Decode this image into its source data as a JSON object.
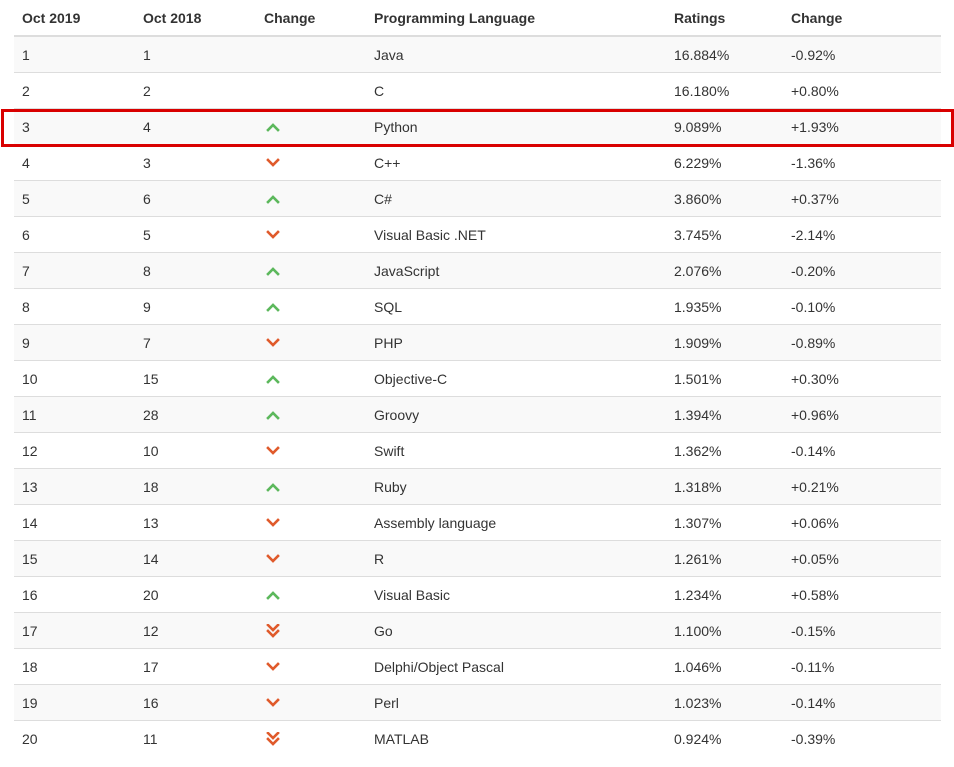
{
  "headers": [
    "Oct 2019",
    "Oct 2018",
    "Change",
    "Programming Language",
    "Ratings",
    "Change"
  ],
  "colors": {
    "up": "#5cb85c",
    "down": "#e05a2b",
    "highlight": "#d90000"
  },
  "highlighted_language": "Python",
  "rows": [
    {
      "now": "1",
      "prev": "1",
      "trend": "none",
      "language": "Java",
      "rating": "16.884%",
      "change": "-0.92%"
    },
    {
      "now": "2",
      "prev": "2",
      "trend": "none",
      "language": "C",
      "rating": "16.180%",
      "change": "+0.80%"
    },
    {
      "now": "3",
      "prev": "4",
      "trend": "up",
      "language": "Python",
      "rating": "9.089%",
      "change": "+1.93%"
    },
    {
      "now": "4",
      "prev": "3",
      "trend": "down",
      "language": "C++",
      "rating": "6.229%",
      "change": "-1.36%"
    },
    {
      "now": "5",
      "prev": "6",
      "trend": "up",
      "language": "C#",
      "rating": "3.860%",
      "change": "+0.37%"
    },
    {
      "now": "6",
      "prev": "5",
      "trend": "down",
      "language": "Visual Basic .NET",
      "rating": "3.745%",
      "change": "-2.14%"
    },
    {
      "now": "7",
      "prev": "8",
      "trend": "up",
      "language": "JavaScript",
      "rating": "2.076%",
      "change": "-0.20%"
    },
    {
      "now": "8",
      "prev": "9",
      "trend": "up",
      "language": "SQL",
      "rating": "1.935%",
      "change": "-0.10%"
    },
    {
      "now": "9",
      "prev": "7",
      "trend": "down",
      "language": "PHP",
      "rating": "1.909%",
      "change": "-0.89%"
    },
    {
      "now": "10",
      "prev": "15",
      "trend": "upup",
      "language": "Objective-C",
      "rating": "1.501%",
      "change": "+0.30%"
    },
    {
      "now": "11",
      "prev": "28",
      "trend": "upup",
      "language": "Groovy",
      "rating": "1.394%",
      "change": "+0.96%"
    },
    {
      "now": "12",
      "prev": "10",
      "trend": "down",
      "language": "Swift",
      "rating": "1.362%",
      "change": "-0.14%"
    },
    {
      "now": "13",
      "prev": "18",
      "trend": "upup",
      "language": "Ruby",
      "rating": "1.318%",
      "change": "+0.21%"
    },
    {
      "now": "14",
      "prev": "13",
      "trend": "down",
      "language": "Assembly language",
      "rating": "1.307%",
      "change": "+0.06%"
    },
    {
      "now": "15",
      "prev": "14",
      "trend": "down",
      "language": "R",
      "rating": "1.261%",
      "change": "+0.05%"
    },
    {
      "now": "16",
      "prev": "20",
      "trend": "upup",
      "language": "Visual Basic",
      "rating": "1.234%",
      "change": "+0.58%"
    },
    {
      "now": "17",
      "prev": "12",
      "trend": "downdown",
      "language": "Go",
      "rating": "1.100%",
      "change": "-0.15%"
    },
    {
      "now": "18",
      "prev": "17",
      "trend": "down",
      "language": "Delphi/Object Pascal",
      "rating": "1.046%",
      "change": "-0.11%"
    },
    {
      "now": "19",
      "prev": "16",
      "trend": "down",
      "language": "Perl",
      "rating": "1.023%",
      "change": "-0.14%"
    },
    {
      "now": "20",
      "prev": "11",
      "trend": "downdown",
      "language": "MATLAB",
      "rating": "0.924%",
      "change": "-0.39%"
    }
  ]
}
